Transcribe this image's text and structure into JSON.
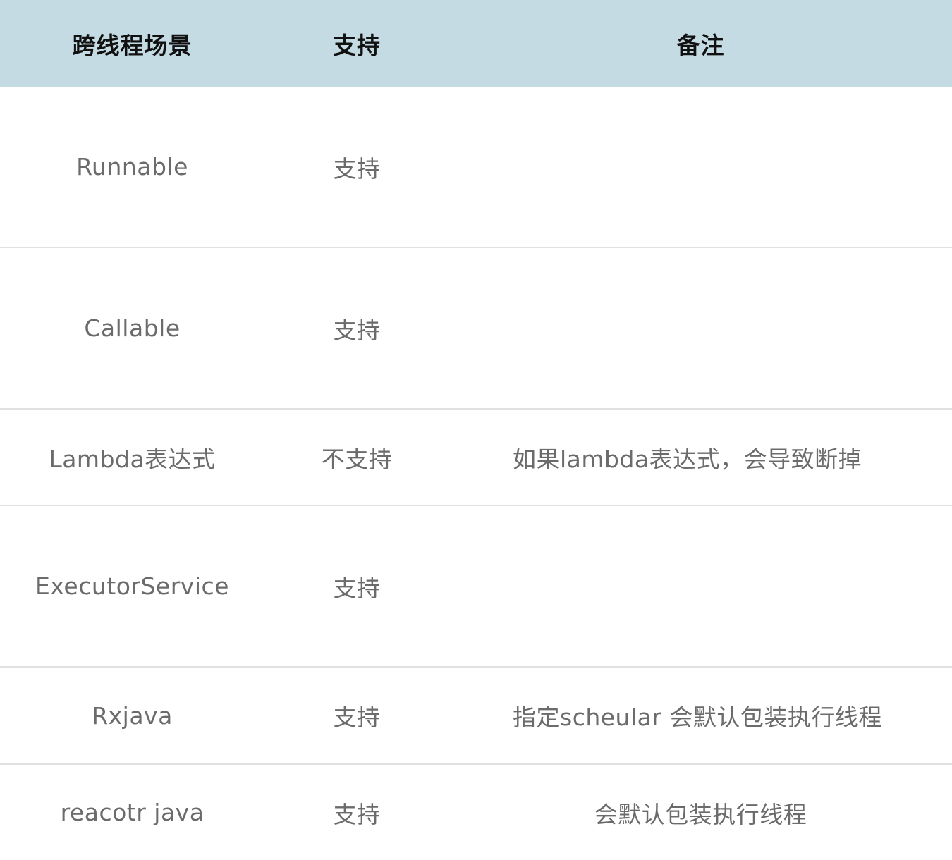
{
  "table": {
    "headers": [
      "跨线程场景",
      "支持",
      "备注"
    ],
    "rows": [
      {
        "scene": "Runnable",
        "support": "支持",
        "note": ""
      },
      {
        "scene": "Callable",
        "support": "支持",
        "note": ""
      },
      {
        "scene": "Lambda表达式",
        "support": "不支持",
        "note": "如果lambda表达式，会导致断掉"
      },
      {
        "scene": "ExecutorService",
        "support": "支持",
        "note": ""
      },
      {
        "scene": "Rxjava",
        "support": "支持",
        "note": "指定scheular 会默认包装执行线程"
      },
      {
        "scene": "reacotr java",
        "support": "支持",
        "note": "会默认包装执行线程"
      }
    ]
  },
  "colors": {
    "header_bg": "#c5dbe3",
    "header_text": "#111111",
    "body_text": "#6b6b6b",
    "divider": "#e1e1e1"
  }
}
